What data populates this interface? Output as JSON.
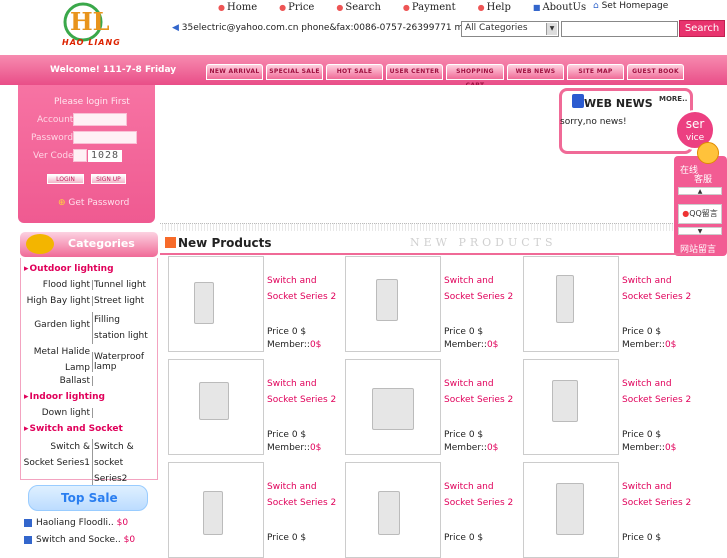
{
  "header": {
    "logo_letters": "HL",
    "logo_sub": "HAO LIANG",
    "nav": [
      "Home",
      "Price",
      "Search",
      "Payment",
      "Help",
      "AboutUs"
    ],
    "set_homepage": "Set Homepage",
    "contact": "35electric@yahoo.com.cn phone&fax:0086-0757-26399771 mobile:",
    "category_select": "All Categories",
    "search_button": "Search"
  },
  "bar": {
    "welcome": "Welcome! 111-7-8 Friday",
    "tabs": [
      "NEW ARRIVAL",
      "SPECIAL SALE",
      "HOT SALE",
      "USER CENTER",
      "SHOPPING CART",
      "WEB NEWS",
      "SITE MAP",
      "GUEST BOOK"
    ]
  },
  "login": {
    "title": "Please login First",
    "account_label": "Account",
    "password_label": "Password",
    "vercode_label": "Ver Code",
    "vercode_value": "1028",
    "login_btn": "LOGIN",
    "signup_btn": "SIGN UP",
    "get_password": "Get Password"
  },
  "news": {
    "title": "WEB NEWS",
    "more": "MORE..",
    "text": "sorry,no news!"
  },
  "service": {
    "circle_line1": "ser",
    "circle_line2": "vice",
    "online": "在线",
    "kefu": "客服",
    "qq": "QQ留言",
    "guestbook": "网站留言"
  },
  "categories": {
    "title": "Categories",
    "outdoor": "Outdoor lighting",
    "outdoor_items": [
      "Flood light",
      "Tunnel light",
      "High Bay light",
      "Street light",
      "Garden light",
      "Filling station light",
      "Metal Halide Lamp",
      "Waterproof lamp",
      "Ballast"
    ],
    "indoor": "Indoor lighting",
    "indoor_items": [
      "Down light"
    ],
    "switch": "Switch and Socket",
    "switch_items": [
      "Switch & Socket Series1",
      "Switch & socket Series2"
    ]
  },
  "top_sale": {
    "title": "Top Sale",
    "items": [
      {
        "name": "Haoliang Floodli..",
        "price": "$0"
      },
      {
        "name": "Switch and Socke..",
        "price": "$0"
      }
    ]
  },
  "new_products": {
    "title": "New Products",
    "watermark": "NEW PRODUCTS",
    "items": [
      {
        "name1": "Switch and",
        "name2": "Socket Series 2",
        "price": "Price 0 $",
        "member": "Member::",
        "member_val": "0$"
      },
      {
        "name1": "Switch and",
        "name2": "Socket Series 2",
        "price": "Price 0 $",
        "member": "Member::",
        "member_val": "0$"
      },
      {
        "name1": "Switch and",
        "name2": "Socket Series 2",
        "price": "Price 0 $",
        "member": "Member::",
        "member_val": "0$"
      },
      {
        "name1": "Switch and",
        "name2": "Socket Series 2",
        "price": "Price 0 $",
        "member": "Member::",
        "member_val": "0$"
      },
      {
        "name1": "Switch and",
        "name2": "Socket Series 2",
        "price": "Price 0 $",
        "member": "Member::",
        "member_val": "0$"
      },
      {
        "name1": "Switch and",
        "name2": "Socket Series 2",
        "price": "Price 0 $",
        "member": "Member::",
        "member_val": "0$"
      },
      {
        "name1": "Switch and",
        "name2": "Socket Series 2",
        "price": "Price 0 $"
      },
      {
        "name1": "Switch and",
        "name2": "Socket Series 2",
        "price": "Price 0 $"
      },
      {
        "name1": "Switch and",
        "name2": "Socket Series 2",
        "price": "Price 0 $"
      }
    ]
  }
}
